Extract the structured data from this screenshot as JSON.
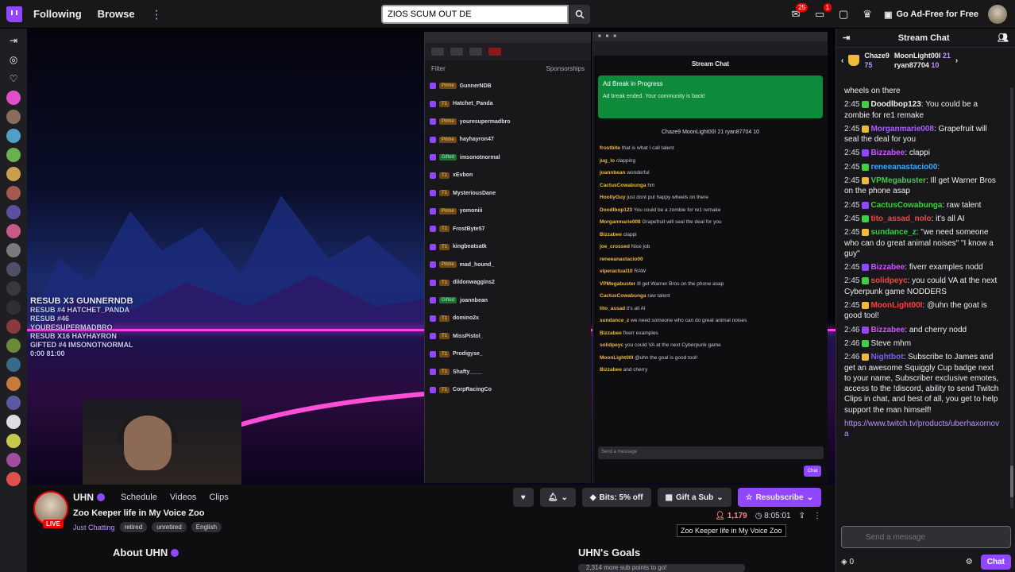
{
  "topnav": {
    "following": "Following",
    "browse": "Browse",
    "search_value": "ZIOS SCUM OUT DE",
    "inbox_count": "25",
    "notif_count": "1",
    "adfree": "Go Ad-Free for Free"
  },
  "overlay": {
    "alerts": [
      "RESUB X3 GUNNERNDB",
      "RESUB #4 HATCHET_PANDA",
      "RESUB #46 YOURESUPERMADBRO",
      "RESUB X16 HAYHAYRON",
      "GIFTED #4 IMSONOTNORMAL"
    ],
    "counter": "0:00 81:00"
  },
  "dashboard": {
    "filter": "Filter",
    "sponsor": "Sponsorships",
    "events": [
      {
        "tag": "Prime",
        "name": "GunnerNDB",
        "gift": false
      },
      {
        "tag": "T1",
        "name": "Hatchet_Panda",
        "gift": false
      },
      {
        "tag": "Prime",
        "name": "youresupermadbro",
        "gift": false
      },
      {
        "tag": "Prime",
        "name": "hayhayron47",
        "gift": false
      },
      {
        "tag": "Gifted",
        "name": "imsonotnormal",
        "gift": true
      },
      {
        "tag": "T1",
        "name": "xEvbon",
        "gift": false
      },
      {
        "tag": "T1",
        "name": "MysteriousDane",
        "gift": false
      },
      {
        "tag": "Prime",
        "name": "yomoniii",
        "gift": false
      },
      {
        "tag": "T1",
        "name": "FrostByte57",
        "gift": false
      },
      {
        "tag": "T1",
        "name": "kingbeatsatk",
        "gift": false
      },
      {
        "tag": "Prime",
        "name": "mad_hound_",
        "gift": false
      },
      {
        "tag": "T1",
        "name": "dildonwaggins2",
        "gift": false
      },
      {
        "tag": "Gifted",
        "name": "joannbean",
        "gift": true
      },
      {
        "tag": "T1",
        "name": "domino2x",
        "gift": false
      },
      {
        "tag": "T1",
        "name": "MissPistol_",
        "gift": false
      },
      {
        "tag": "T1",
        "name": "Prodigyse_",
        "gift": false
      },
      {
        "tag": "T1",
        "name": "Shafty____",
        "gift": false
      },
      {
        "tag": "T1",
        "name": "CorpRacingCo",
        "gift": false
      }
    ]
  },
  "popout": {
    "title": "Stream Chat",
    "ad_title": "Ad Break in Progress",
    "ad_sub": "Ad break ended. Your community is back!",
    "leader": "Chaze9  MoonLight00I 21  ryan87704 10",
    "messages": [
      {
        "name": "frostbite",
        "text": "that is what I call talent"
      },
      {
        "name": "jug_lo",
        "text": "clapping"
      },
      {
        "name": "joannbean",
        "text": "wonderful"
      },
      {
        "name": "CactusCowabunga",
        "text": "hm"
      },
      {
        "name": "HoollyGuy",
        "text": "just dont put happy wheels on there"
      },
      {
        "name": "Doodlbop123",
        "text": "You could be a zombie for re1 remake"
      },
      {
        "name": "Morganmarie008",
        "text": "Grapefruit will seal the deal for you"
      },
      {
        "name": "Bizzabee",
        "text": "clappi"
      },
      {
        "name": "joe_crossed",
        "text": "Nice job"
      },
      {
        "name": "reneeanastacio00",
        "text": ""
      },
      {
        "name": "viperactual10",
        "text": "RAW"
      },
      {
        "name": "VPMegabuster",
        "text": "Ill get Warner Bros on the phone asap"
      },
      {
        "name": "CactusCowabunga",
        "text": "raw talent"
      },
      {
        "name": "tito_assad",
        "text": "it's all AI"
      },
      {
        "name": "sundance_z",
        "text": "we need someone who can do great animal noises"
      },
      {
        "name": "Bizzabee",
        "text": "fiverr examples"
      },
      {
        "name": "solidpeyc",
        "text": "you could VA at the next Cyberpunk game"
      },
      {
        "name": "MoonLight00I",
        "text": "@uhn the goal is good tool!"
      },
      {
        "name": "Bizzabee",
        "text": "and cherry"
      }
    ],
    "input": "Send a message",
    "chat_btn": "Chat"
  },
  "channel": {
    "live": "LIVE",
    "name": "UHN",
    "schedule": "Schedule",
    "videos": "Videos",
    "clips": "Clips",
    "title": "Zoo Keeper life in My Voice Zoo",
    "category": "Just Chatting",
    "tags": [
      "retired",
      "unretired",
      "English"
    ],
    "bits": "Bits: 5% off",
    "gift": "Gift a Sub",
    "resub": "Resubscribe",
    "viewers": "1,179",
    "uptime": "8:05:01",
    "tooltip": "Zoo Keeper life in My Voice Zoo",
    "about": "About UHN",
    "goals": "UHN's Goals",
    "goal_text": "2,314 more sub points to go!"
  },
  "chat": {
    "title": "Stream Chat",
    "leaderboard": {
      "first": "Chaze9",
      "first_pts": "75",
      "second": "MoonLight00I",
      "second_pts": "21",
      "third": "ryan87704",
      "third_pts": "10"
    },
    "messages": [
      {
        "ts": "",
        "user": "",
        "color": "#efeff1",
        "text": "wheels on there"
      },
      {
        "ts": "2:45",
        "user": "Doodlbop123",
        "color": "#efeff1",
        "text": "You could be a zombie for re1 remake"
      },
      {
        "ts": "2:45",
        "user": "Morganmarie008",
        "color": "#b05cff",
        "text": "Grapefruit will seal the deal for you"
      },
      {
        "ts": "2:45",
        "user": "Bizzabee",
        "color": "#d154ff",
        "text": "clappi"
      },
      {
        "ts": "2:45",
        "user": "reneeanastacio00",
        "color": "#3da8ff",
        "text": ""
      },
      {
        "ts": "2:45",
        "user": "VPMegabuster",
        "color": "#3ecf45",
        "text": "Ill get Warner Bros on the phone asap"
      },
      {
        "ts": "2:45",
        "user": "CactusCowabunga",
        "color": "#3ecf45",
        "text": "raw talent"
      },
      {
        "ts": "2:45",
        "user": "tito_assad_nolo",
        "color": "#ff4040",
        "text": "it's all AI"
      },
      {
        "ts": "2:45",
        "user": "sundance_z",
        "color": "#3ecf45",
        "text": "\"we need someone who can do great animal noises\" \"I know a guy\""
      },
      {
        "ts": "2:45",
        "user": "Bizzabee",
        "color": "#d154ff",
        "text": "fiverr examples nodd"
      },
      {
        "ts": "2:45",
        "user": "solidpeyc",
        "color": "#ff4040",
        "text": "you could VA at the next Cyberpunk game NODDERS"
      },
      {
        "ts": "2:45",
        "user": "MoonLight00I",
        "color": "#ff4040",
        "text": "@uhn the goat is good tool!"
      },
      {
        "ts": "2:46",
        "user": "Bizzabee",
        "color": "#d154ff",
        "text": "and cherry nodd"
      },
      {
        "ts": "2:46",
        "user": "",
        "color": "#3d6bff",
        "text": "Steve mhm"
      },
      {
        "ts": "2:46",
        "user": "Nightbot",
        "color": "#7a5cff",
        "text": "Subscribe to James and get an awesome Squiggly Cup badge next to your name, Subscriber exclusive emotes, access to the !discord, ability to send Twitch Clips in chat, and best of all, you get to help support the man himself!"
      }
    ],
    "link": "https://www.twitch.tv/products/uberhaxornova",
    "input_placeholder": "Send a message",
    "points": "0",
    "chat_btn": "Chat"
  }
}
